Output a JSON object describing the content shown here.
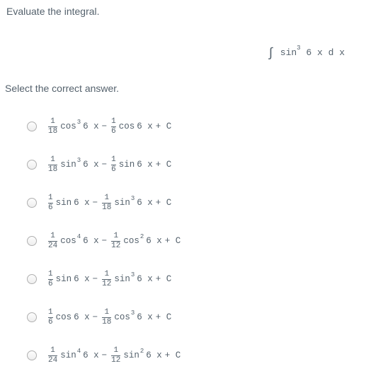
{
  "question": "Evaluate the integral.",
  "integral": {
    "func": "sin",
    "pow": "3",
    "arg": "6 x d x"
  },
  "selectPrompt": "Select the correct answer.",
  "options": [
    {
      "t1_num": "1",
      "t1_den": "18",
      "t1_func": "cos",
      "t1_pow": "3",
      "t1_arg": "6 x",
      "t2_num": "1",
      "t2_den": "6",
      "t2_func": "cos",
      "t2_pow": "",
      "t2_arg": "6 x",
      "c": "+ C"
    },
    {
      "t1_num": "1",
      "t1_den": "18",
      "t1_func": "sin",
      "t1_pow": "3",
      "t1_arg": "6 x",
      "t2_num": "1",
      "t2_den": "6",
      "t2_func": "sin",
      "t2_pow": "",
      "t2_arg": "6 x",
      "c": "+ C"
    },
    {
      "t1_num": "1",
      "t1_den": "6",
      "t1_func": "sin",
      "t1_pow": "",
      "t1_arg": "6 x",
      "t2_num": "1",
      "t2_den": "18",
      "t2_func": "sin",
      "t2_pow": "3",
      "t2_arg": "6 x",
      "c": "+ C"
    },
    {
      "t1_num": "1",
      "t1_den": "24",
      "t1_func": "cos",
      "t1_pow": "4",
      "t1_arg": "6 x",
      "t2_num": "1",
      "t2_den": "12",
      "t2_func": "cos",
      "t2_pow": "2",
      "t2_arg": "6 x",
      "c": "+ C"
    },
    {
      "t1_num": "1",
      "t1_den": "6",
      "t1_func": "sin",
      "t1_pow": "",
      "t1_arg": "6 x",
      "t2_num": "1",
      "t2_den": "12",
      "t2_func": "sin",
      "t2_pow": "3",
      "t2_arg": "6 x",
      "c": "+ C"
    },
    {
      "t1_num": "1",
      "t1_den": "6",
      "t1_func": "cos",
      "t1_pow": "",
      "t1_arg": "6 x",
      "t2_num": "1",
      "t2_den": "18",
      "t2_func": "cos",
      "t2_pow": "3",
      "t2_arg": "6 x",
      "c": "+ C"
    },
    {
      "t1_num": "1",
      "t1_den": "24",
      "t1_func": "sin",
      "t1_pow": "4",
      "t1_arg": "6 x",
      "t2_num": "1",
      "t2_den": "12",
      "t2_func": "sin",
      "t2_pow": "2",
      "t2_arg": "6 x",
      "c": "+ C"
    }
  ]
}
